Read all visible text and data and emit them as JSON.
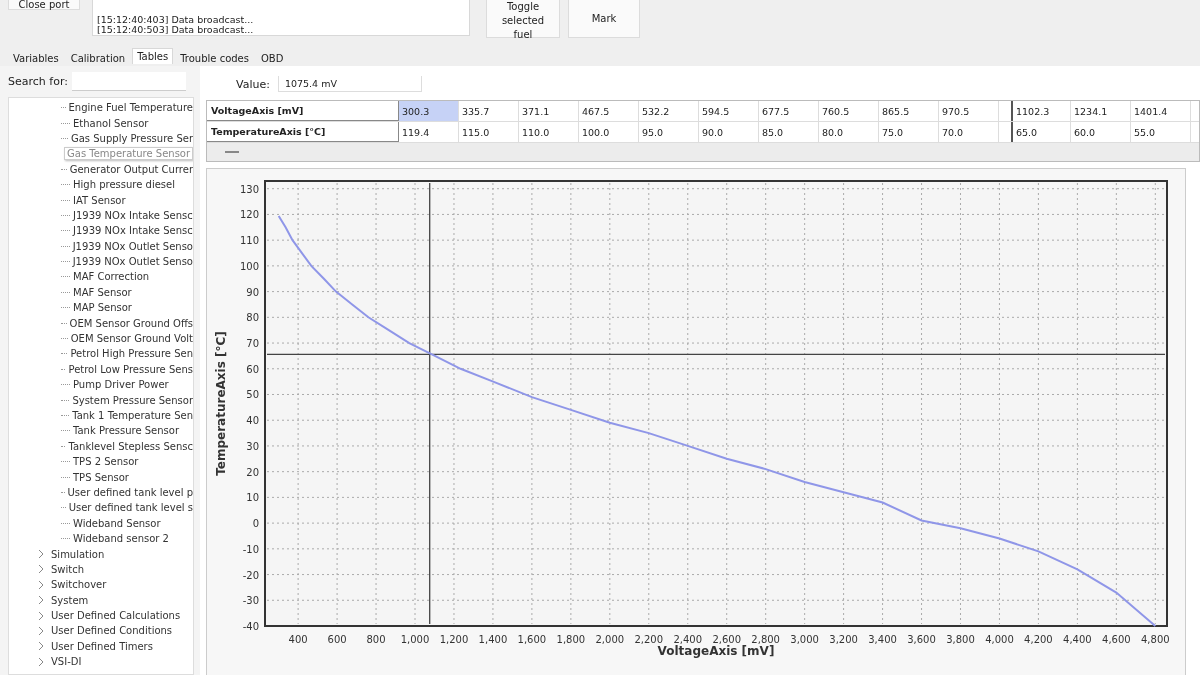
{
  "toolbar": {
    "close_port": "Close port",
    "log": [
      "[15:12:40:403] Data broadcast...",
      "[15:12:40:503] Data broadcast..."
    ],
    "buttons": [
      "Toggle selected fuel",
      "Mark"
    ]
  },
  "tabs": [
    {
      "label": "Variables",
      "selected": false
    },
    {
      "label": "Calibration",
      "selected": false
    },
    {
      "label": "Tables",
      "selected": true
    },
    {
      "label": "Trouble codes",
      "selected": false
    },
    {
      "label": "OBD",
      "selected": false
    }
  ],
  "search": {
    "label": "Search for:"
  },
  "tree": {
    "branch_children": [
      {
        "label": "Engine Fuel Temperature",
        "selected": false
      },
      {
        "label": "Ethanol Sensor",
        "selected": false
      },
      {
        "label": "Gas Supply Pressure Ser",
        "selected": false
      },
      {
        "label": "Gas Temperature Sensor",
        "selected": true
      },
      {
        "label": "Generator Output Currer",
        "selected": false
      },
      {
        "label": "High pressure diesel",
        "selected": false
      },
      {
        "label": "IAT Sensor",
        "selected": false
      },
      {
        "label": "J1939 NOx Intake Sensc",
        "selected": false
      },
      {
        "label": "J1939 NOx Intake Sensc",
        "selected": false
      },
      {
        "label": "J1939 NOx Outlet Senso",
        "selected": false
      },
      {
        "label": "J1939 NOx Outlet Senso",
        "selected": false
      },
      {
        "label": "MAF Correction",
        "selected": false
      },
      {
        "label": "MAF Sensor",
        "selected": false
      },
      {
        "label": "MAP Sensor",
        "selected": false
      },
      {
        "label": "OEM Sensor Ground Offs",
        "selected": false
      },
      {
        "label": "OEM Sensor Ground Volt",
        "selected": false
      },
      {
        "label": "Petrol High Pressure Sen",
        "selected": false
      },
      {
        "label": "Petrol Low Pressure Sens",
        "selected": false
      },
      {
        "label": "Pump Driver Power",
        "selected": false
      },
      {
        "label": "System Pressure Sensor",
        "selected": false
      },
      {
        "label": "Tank 1 Temperature Sen",
        "selected": false
      },
      {
        "label": "Tank Pressure Sensor",
        "selected": false
      },
      {
        "label": "Tanklevel Stepless Sensc",
        "selected": false
      },
      {
        "label": "TPS 2 Sensor",
        "selected": false
      },
      {
        "label": "TPS Sensor",
        "selected": false
      },
      {
        "label": "User defined tank level p",
        "selected": false
      },
      {
        "label": "User defined tank level s",
        "selected": false
      },
      {
        "label": "Wideband Sensor",
        "selected": false
      },
      {
        "label": "Wideband sensor 2",
        "selected": false
      }
    ],
    "items": [
      {
        "label": "Simulation",
        "expanded": false
      },
      {
        "label": "Switch",
        "expanded": false
      },
      {
        "label": "Switchover",
        "expanded": false
      },
      {
        "label": "System",
        "expanded": false
      },
      {
        "label": "User Defined Calculations",
        "expanded": false
      },
      {
        "label": "User Defined Conditions",
        "expanded": false
      },
      {
        "label": "User Defined Timers",
        "expanded": false
      },
      {
        "label": "VSI-DI",
        "expanded": false
      }
    ]
  },
  "value": {
    "label": "Value:",
    "value": "1075.4 mV"
  },
  "table": {
    "rows": [
      {
        "header": "VoltageAxis [mV]",
        "cells": [
          {
            "text": "300.3",
            "selected": true
          },
          {
            "text": "335.7",
            "selected": false
          },
          {
            "text": "371.1",
            "selected": false
          },
          {
            "text": "467.5",
            "selected": false
          },
          {
            "text": "532.2",
            "selected": false
          },
          {
            "text": "594.5",
            "selected": false
          },
          {
            "text": "677.5",
            "selected": false
          },
          {
            "text": "760.5",
            "selected": false
          },
          {
            "text": "865.5",
            "selected": false
          },
          {
            "text": "970.5",
            "selected": false
          },
          {
            "text": "1102.3",
            "selected": false
          },
          {
            "text": "1234.1",
            "selected": false
          },
          {
            "text": "1401.4",
            "selected": false
          }
        ]
      },
      {
        "header": "TemperatureAxis [°C]",
        "cells": [
          {
            "text": "119.4",
            "selected": false
          },
          {
            "text": "115.0",
            "selected": false
          },
          {
            "text": "110.0",
            "selected": false
          },
          {
            "text": "100.0",
            "selected": false
          },
          {
            "text": "95.0",
            "selected": false
          },
          {
            "text": "90.0",
            "selected": false
          },
          {
            "text": "85.0",
            "selected": false
          },
          {
            "text": "80.0",
            "selected": false
          },
          {
            "text": "75.0",
            "selected": false
          },
          {
            "text": "70.0",
            "selected": false
          },
          {
            "text": "65.0",
            "selected": false
          },
          {
            "text": "60.0",
            "selected": false
          },
          {
            "text": "55.0",
            "selected": false
          }
        ]
      }
    ]
  },
  "chart_data": {
    "type": "line",
    "xlabel": "VoltageAxis [mV]",
    "ylabel": "TemperatureAxis [°C]",
    "xlim": [
      230,
      4860
    ],
    "ylim": [
      -40,
      133
    ],
    "xticks": [
      {
        "value": 400,
        "label": "400"
      },
      {
        "value": 600,
        "label": "600"
      },
      {
        "value": 800,
        "label": "800"
      },
      {
        "value": 1000,
        "label": "1,000"
      },
      {
        "value": 1200,
        "label": "1,200"
      },
      {
        "value": 1400,
        "label": "1,400"
      },
      {
        "value": 1600,
        "label": "1,600"
      },
      {
        "value": 1800,
        "label": "1,800"
      },
      {
        "value": 2000,
        "label": "2,000"
      },
      {
        "value": 2200,
        "label": "2,200"
      },
      {
        "value": 2400,
        "label": "2,400"
      },
      {
        "value": 2600,
        "label": "2,600"
      },
      {
        "value": 2800,
        "label": "2,800"
      },
      {
        "value": 3000,
        "label": "3,000"
      },
      {
        "value": 3200,
        "label": "3,200"
      },
      {
        "value": 3400,
        "label": "3,400"
      },
      {
        "value": 3600,
        "label": "3,600"
      },
      {
        "value": 3800,
        "label": "3,800"
      },
      {
        "value": 4000,
        "label": "4,000"
      },
      {
        "value": 4200,
        "label": "4,200"
      },
      {
        "value": 4400,
        "label": "4,400"
      },
      {
        "value": 4600,
        "label": "4,600"
      },
      {
        "value": 4800,
        "label": "4,800"
      }
    ],
    "yticks": [
      130,
      120,
      110,
      100,
      90,
      80,
      70,
      60,
      50,
      40,
      30,
      20,
      10,
      0,
      -10,
      -20,
      -30,
      -40
    ],
    "x": [
      300.3,
      335.7,
      371.1,
      467.5,
      532.2,
      594.5,
      677.5,
      760.5,
      865.5,
      970.5,
      1102.3,
      1234.1,
      1401.4,
      1600,
      1800,
      2000,
      2200,
      2400,
      2600,
      2800,
      3000,
      3200,
      3400,
      3600,
      3800,
      4000,
      4200,
      4400,
      4600,
      4800
    ],
    "series": [
      {
        "color": "#8f96e8",
        "values": [
          119.4,
          115,
          110,
          100,
          95,
          90,
          85,
          80,
          75,
          70,
          65,
          60,
          55,
          49,
          44,
          39,
          35,
          30,
          25,
          21,
          16,
          12,
          8,
          1,
          -2,
          -6,
          -11,
          -18,
          -27,
          -40
        ]
      }
    ],
    "grid": true,
    "ref_lines": [
      {
        "axis": "x",
        "value": 1075.4
      },
      {
        "axis": "y",
        "value": 65.6
      }
    ]
  }
}
